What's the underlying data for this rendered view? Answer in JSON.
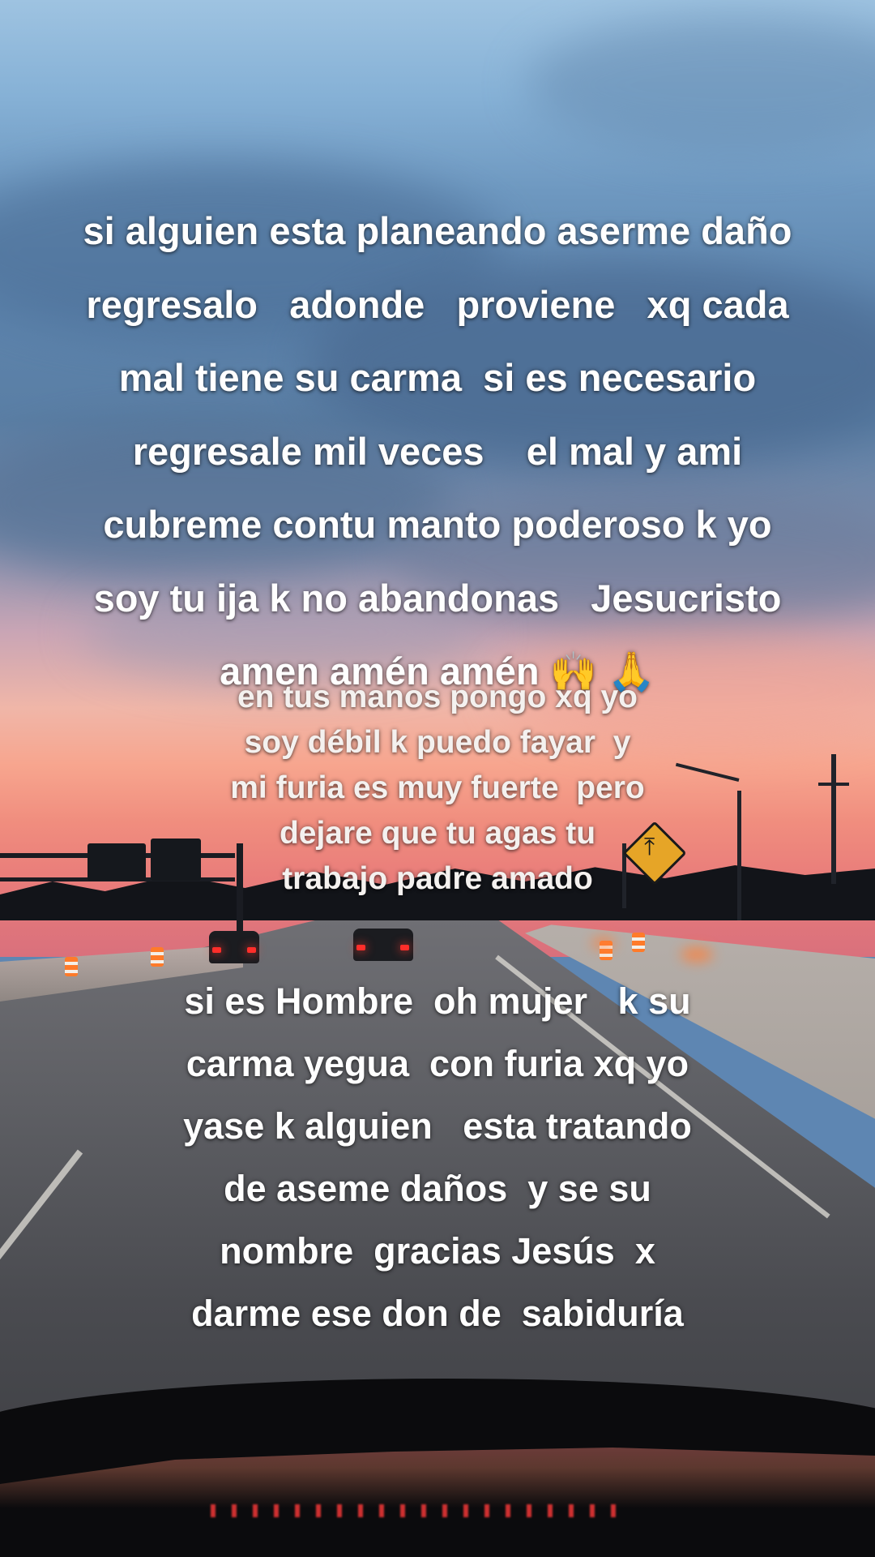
{
  "caption_block_1": {
    "lines": [
      "si alguien esta planeando aserme daño",
      "regresalo   adonde   proviene   xq cada",
      "mal tiene su carma  si es necesario",
      "regresale mil veces    el mal y ami",
      "cubreme contu manto poderoso k yo",
      "soy tu ija k no abandonas   Jesucristo",
      "amen amén amén"
    ],
    "emojis": [
      "🙌",
      "🙏"
    ]
  },
  "caption_block_2": {
    "lines": [
      "en tus manos pongo xq yo",
      "soy débil k puedo fayar  y",
      "mi furia es muy fuerte  pero",
      "dejare que tu agas tu",
      "trabajo padre amado"
    ]
  },
  "caption_block_3": {
    "lines": [
      "si es Hombre  oh mujer   k su",
      "carma yegua  con furia xq yo",
      "yase k alguien   esta tratando",
      "de aseme daños  y se su",
      "nombre  gracias Jesús  x",
      "darme ese don de  sabiduría"
    ]
  },
  "scene": {
    "description_icon": "highway-sunset-photo",
    "colors": {
      "sky_top": "#9ec3e1",
      "sunset": "#f7a58e",
      "road": "#5d5e63"
    }
  }
}
